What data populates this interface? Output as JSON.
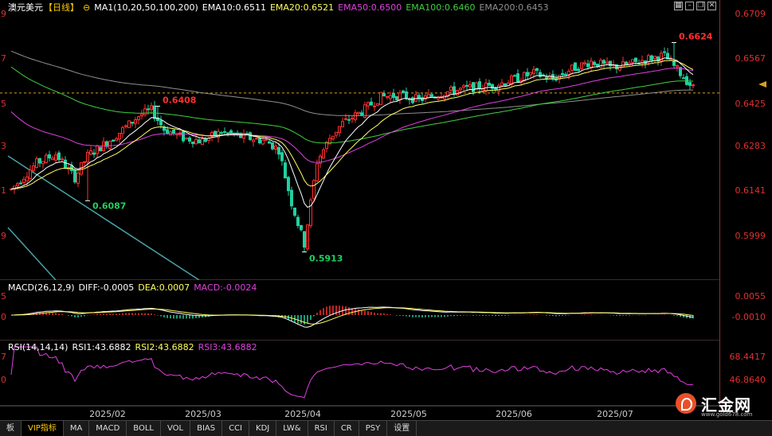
{
  "header": {
    "symbol": "澳元美元",
    "period": "【日线】",
    "ma_label": "MA1(10,20,50,100,200)",
    "ema10": "EMA10:0.6511",
    "ema20": "EMA20:0.6521",
    "ema50": "EMA50:0.6500",
    "ema100": "EMA100:0.6460",
    "ema200": "EMA200:0.6453"
  },
  "price_axis": [
    "0.6709",
    "0.6567",
    "0.6425",
    "0.6283",
    "0.6141",
    "0.5999"
  ],
  "left_axis_digits": [
    "9",
    "7",
    "5",
    "3",
    "1",
    "9"
  ],
  "annotations": {
    "high_label": "0.6624",
    "feb_high_label": "0.6408",
    "feb_low_label": "0.6087",
    "april_low_label": "0.5913"
  },
  "macd": {
    "label": "MACD(26,12,9)",
    "diff": "DIFF:-0.0005",
    "dea": "DEA:0.0007",
    "macd": "MACD:-0.0024",
    "axis": [
      "0.0055",
      "-0.0010"
    ],
    "left_digits": [
      "5",
      "0"
    ]
  },
  "rsi": {
    "label": "RSI(14,14,14)",
    "rsi1": "RSI1:43.6882",
    "rsi2": "RSI2:43.6882",
    "rsi3": "RSI3:43.6882",
    "axis": [
      "68.4417",
      "46.8640"
    ],
    "left_digits": [
      "7",
      "0"
    ]
  },
  "date_axis": [
    "2025/02",
    "2025/03",
    "2025/04",
    "2025/05",
    "2025/06",
    "2025/07"
  ],
  "tabs": [
    "板",
    "VIP指标",
    "MA",
    "MACD",
    "BOLL",
    "VOL",
    "BIAS",
    "CCI",
    "KDJ",
    "LW&",
    "RSI",
    "CR",
    "PSY",
    "设置"
  ],
  "logo": {
    "name": "汇金网",
    "url": "www.gold678.com"
  },
  "colors": {
    "up": "#ff3030",
    "down": "#20d0a0",
    "ema10": "#ffffff",
    "ema20": "#ffff60",
    "ema50": "#e040e0",
    "ema100": "#40d040",
    "ema200": "#909090",
    "axis_text": "#e03030",
    "trend_line": "#4aa0a8"
  },
  "chart_data": {
    "type": "candlestick",
    "y_range": [
      0.585,
      0.672
    ],
    "key_points": [
      {
        "label": "0.6408",
        "value": 0.6408,
        "date": "2025/02"
      },
      {
        "label": "0.6087",
        "value": 0.6087,
        "date": "2025/02"
      },
      {
        "label": "0.5913",
        "value": 0.5913,
        "date": "2025/04"
      },
      {
        "label": "0.6624",
        "value": 0.6624,
        "date": "2025/07"
      }
    ]
  }
}
